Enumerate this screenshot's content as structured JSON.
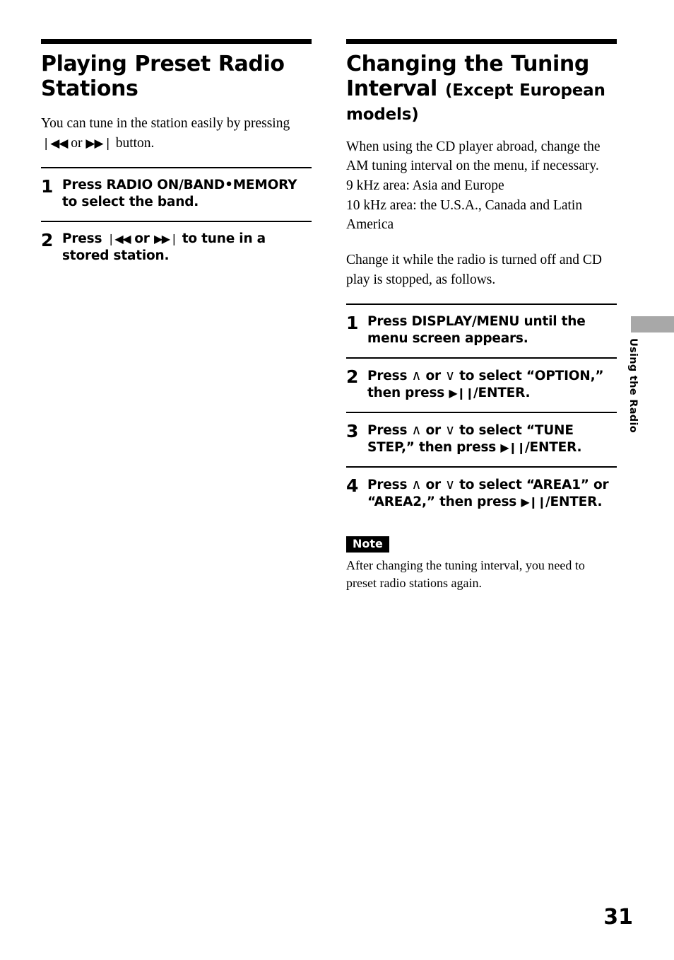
{
  "page": {
    "number": "31",
    "side_tab_label": "Using the Radio"
  },
  "left_column": {
    "heading": "Playing Preset Radio Stations",
    "intro": {
      "part1": "You can tune in the station easily by pressing",
      "icon_prev": "❘◀◀",
      "or": "or",
      "icon_next": "▶▶❘",
      "part2": "button."
    },
    "steps": [
      {
        "number": "1",
        "text": "Press RADIO ON/BAND•MEMORY to select the band."
      },
      {
        "number": "2",
        "text_before": "Press",
        "icon_prev": "❘◀◀",
        "text_mid": "or",
        "icon_next": "▶▶❘",
        "text_after": "to tune in a stored station."
      }
    ]
  },
  "right_column": {
    "heading_main": "Changing the Tuning Interval",
    "heading_small": "(Except European models)",
    "intro_lines": [
      "When using the CD player abroad, change the",
      "AM tuning interval on the menu, if necessary.",
      "9 kHz area: Asia and Europe",
      "10 kHz area: the U.S.A., Canada and Latin",
      "America"
    ],
    "intro_second": "Change it while the radio is turned off and CD play is stopped, as follows.",
    "steps": [
      {
        "number": "1",
        "text": "Press DISPLAY/MENU until the menu screen appears."
      },
      {
        "number": "2",
        "t1": "Press",
        "up": "∧",
        "t2": "or",
        "down": "∨",
        "t3": "to select “OPTION,” then press",
        "play_pause": "▶❙❙",
        "t4": "/ENTER."
      },
      {
        "number": "3",
        "t1": "Press",
        "up": "∧",
        "t2": "or",
        "down": "∨",
        "t3": "to select “TUNE STEP,” then press",
        "play_pause": "▶❙❙",
        "t4": "/ENTER."
      },
      {
        "number": "4",
        "t1": "Press",
        "up": "∧",
        "t2": "or",
        "down": "∨",
        "t3": "to select “AREA1” or “AREA2,” then press",
        "play_pause": "▶❙❙",
        "t4": "/ENTER."
      }
    ],
    "note": {
      "badge": "Note",
      "text": "After changing the tuning interval, you need to preset radio stations again."
    }
  }
}
